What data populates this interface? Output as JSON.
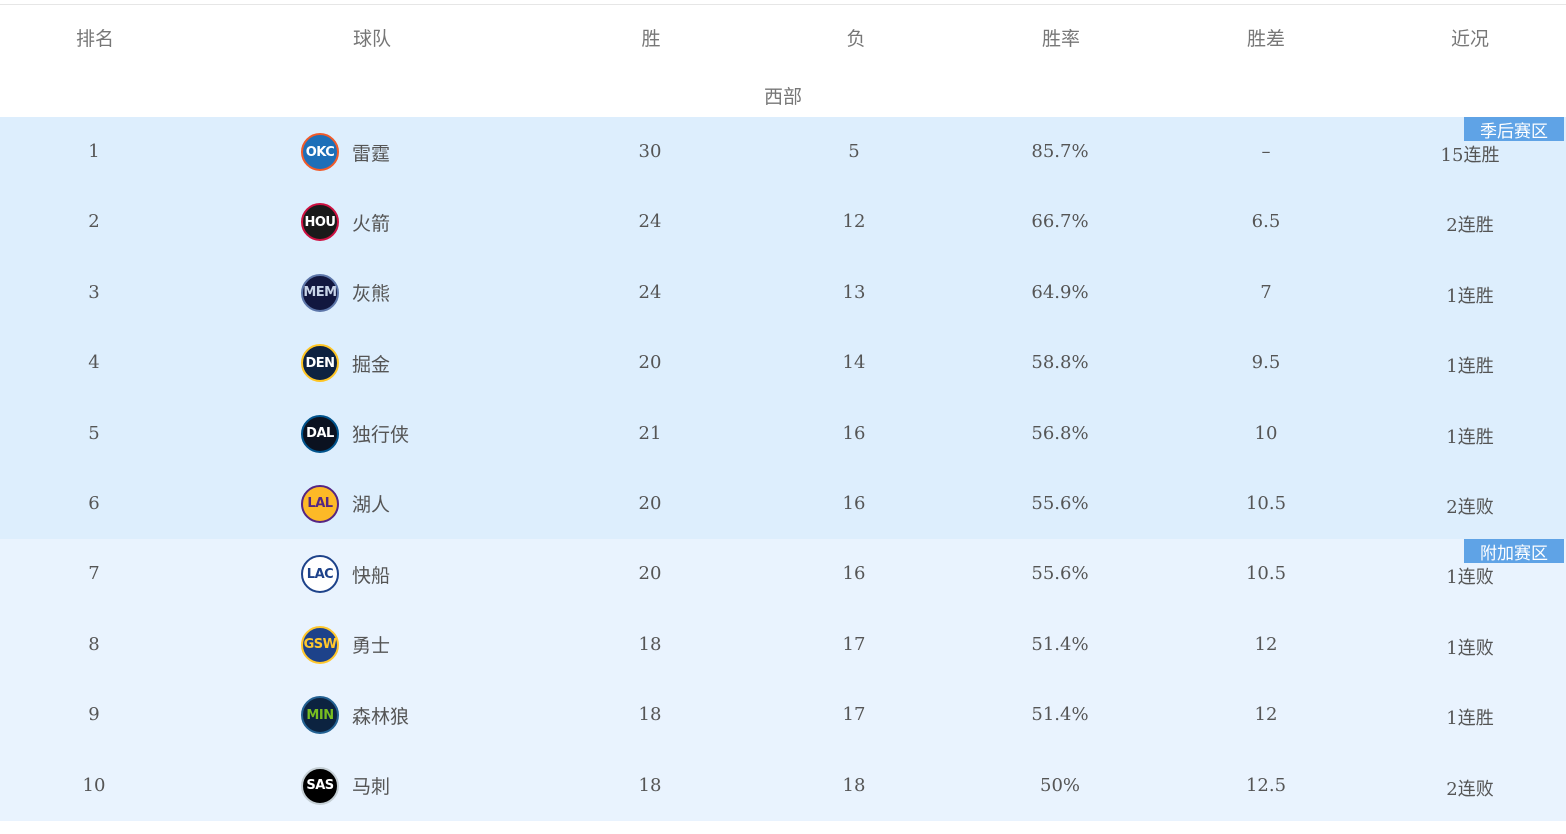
{
  "columns": {
    "rank": "排名",
    "team": "球队",
    "wins": "胜",
    "losses": "负",
    "pct": "胜率",
    "gb": "胜差",
    "streak": "近况"
  },
  "conference": "西部",
  "zones": {
    "playoff": "季后赛区",
    "playin": "附加赛区"
  },
  "colors": {
    "playoff_bg": "#ddeefd",
    "playin_bg": "#e9f3fe",
    "tag_bg": "#5fa3e6"
  },
  "rows": [
    {
      "rank": "1",
      "logo": "OKC",
      "logo_bg": "#1d6fb8",
      "logo_fg": "#ffffff",
      "logo_border": "#f15a29",
      "team": "雷霆",
      "wins": "30",
      "losses": "5",
      "pct": "85.7%",
      "gb": "–",
      "streak": "15连胜",
      "zone": "playoff"
    },
    {
      "rank": "2",
      "logo": "HOU",
      "logo_bg": "#1a1a1a",
      "logo_fg": "#ffffff",
      "logo_border": "#ce1141",
      "team": "火箭",
      "wins": "24",
      "losses": "12",
      "pct": "66.7%",
      "gb": "6.5",
      "streak": "2连胜",
      "zone": "playoff"
    },
    {
      "rank": "3",
      "logo": "MEM",
      "logo_bg": "#12173f",
      "logo_fg": "#c8d4e8",
      "logo_border": "#5d76a9",
      "team": "灰熊",
      "wins": "24",
      "losses": "13",
      "pct": "64.9%",
      "gb": "7",
      "streak": "1连胜",
      "zone": "playoff"
    },
    {
      "rank": "4",
      "logo": "DEN",
      "logo_bg": "#0e2240",
      "logo_fg": "#ffffff",
      "logo_border": "#fec524",
      "team": "掘金",
      "wins": "20",
      "losses": "14",
      "pct": "58.8%",
      "gb": "9.5",
      "streak": "1连胜",
      "zone": "playoff"
    },
    {
      "rank": "5",
      "logo": "DAL",
      "logo_bg": "#0b1220",
      "logo_fg": "#ffffff",
      "logo_border": "#00538c",
      "team": "独行侠",
      "wins": "21",
      "losses": "16",
      "pct": "56.8%",
      "gb": "10",
      "streak": "1连胜",
      "zone": "playoff"
    },
    {
      "rank": "6",
      "logo": "LAL",
      "logo_bg": "#fdb927",
      "logo_fg": "#552583",
      "logo_border": "#552583",
      "team": "湖人",
      "wins": "20",
      "losses": "16",
      "pct": "55.6%",
      "gb": "10.5",
      "streak": "2连败",
      "zone": "playoff"
    },
    {
      "rank": "7",
      "logo": "LAC",
      "logo_bg": "#ffffff",
      "logo_fg": "#1d428a",
      "logo_border": "#1d428a",
      "team": "快船",
      "wins": "20",
      "losses": "16",
      "pct": "55.6%",
      "gb": "10.5",
      "streak": "1连败",
      "zone": "playin"
    },
    {
      "rank": "8",
      "logo": "GSW",
      "logo_bg": "#1d428a",
      "logo_fg": "#ffc72c",
      "logo_border": "#ffc72c",
      "team": "勇士",
      "wins": "18",
      "losses": "17",
      "pct": "51.4%",
      "gb": "12",
      "streak": "1连败",
      "zone": "playin"
    },
    {
      "rank": "9",
      "logo": "MIN",
      "logo_bg": "#0c2340",
      "logo_fg": "#78be20",
      "logo_border": "#236192",
      "team": "森林狼",
      "wins": "18",
      "losses": "17",
      "pct": "51.4%",
      "gb": "12",
      "streak": "1连胜",
      "zone": "playin"
    },
    {
      "rank": "10",
      "logo": "SAS",
      "logo_bg": "#000000",
      "logo_fg": "#ffffff",
      "logo_border": "#c4ced4",
      "team": "马刺",
      "wins": "18",
      "losses": "18",
      "pct": "50%",
      "gb": "12.5",
      "streak": "2连败",
      "zone": "playin"
    }
  ]
}
